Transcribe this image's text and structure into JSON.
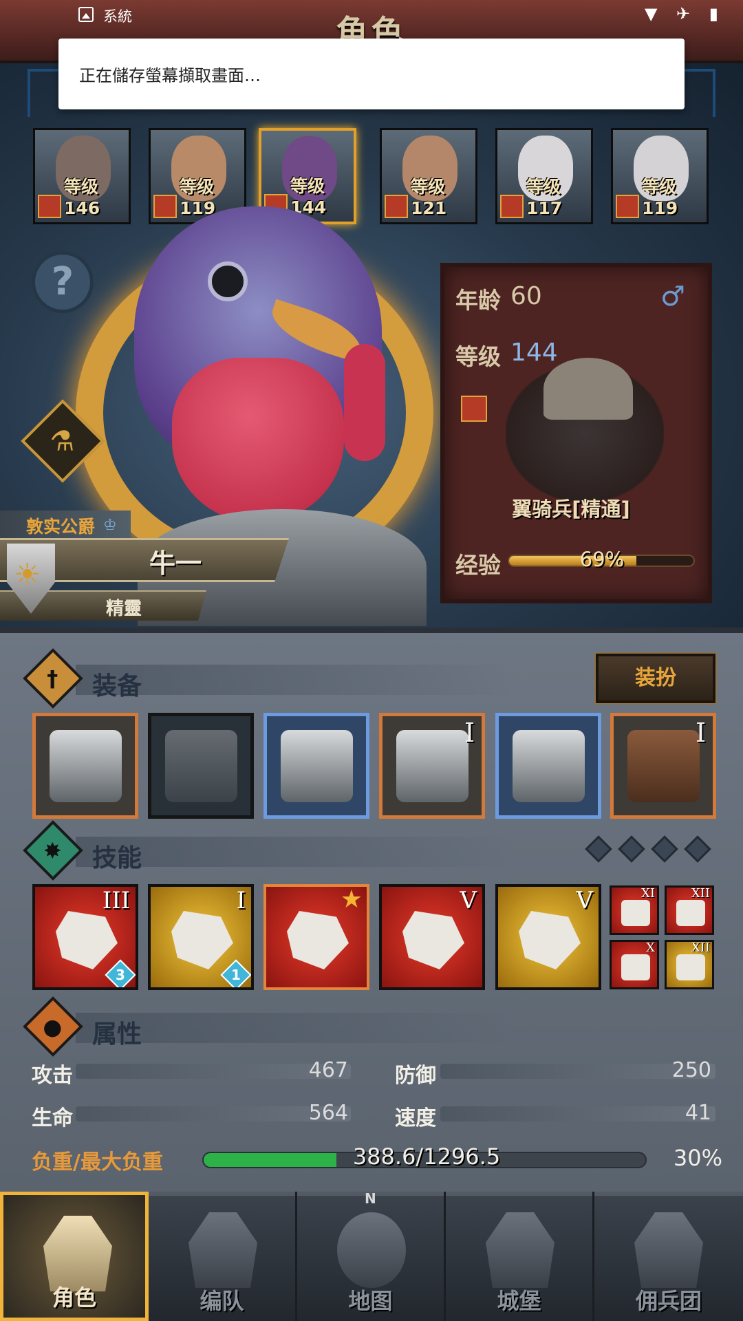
{
  "statusbar": {
    "app": "系統",
    "icons": "▼ ✈ ▮"
  },
  "header": {
    "title": "角色"
  },
  "toast": {
    "text": "正在儲存螢幕擷取畫面…"
  },
  "heroes": [
    {
      "level": "等级146",
      "face": "#7d6a62"
    },
    {
      "level": "等级119",
      "face": "#b88a68"
    },
    {
      "level": "等级144",
      "face": "#6f4a86"
    },
    {
      "level": "等级121",
      "face": "#b4876a"
    },
    {
      "level": "等级117",
      "face": "#d8d6d8"
    },
    {
      "level": "等级119",
      "face": "#d4d2d4"
    }
  ],
  "help": {
    "glyph": "?"
  },
  "potion": {
    "glyph": "⚗"
  },
  "character": {
    "title": "敦实公爵",
    "name": "牛一",
    "race": "精靈"
  },
  "info": {
    "age_label": "年龄",
    "age": "60",
    "gender": "♂",
    "level_label": "等级",
    "level": "144",
    "unit": "翼骑兵[精通]",
    "exp_label": "经验",
    "exp_percent": "69%",
    "exp_fraction": 0.69
  },
  "equipment": {
    "title": "装备",
    "dress_button": "装扮",
    "slots": [
      {
        "style": "",
        "tier": ""
      },
      {
        "style": "dark",
        "tier": ""
      },
      {
        "style": "blue",
        "tier": ""
      },
      {
        "style": "",
        "tier": "I"
      },
      {
        "style": "blue",
        "tier": ""
      },
      {
        "style": "",
        "tier": "I"
      }
    ]
  },
  "skills": {
    "title": "技能",
    "items": [
      {
        "color": "red",
        "tier": "III",
        "gem": "3",
        "star": false
      },
      {
        "color": "gold",
        "tier": "I",
        "gem": "1",
        "star": false
      },
      {
        "color": "red",
        "tier": "",
        "gem": "",
        "star": true
      },
      {
        "color": "red",
        "tier": "V",
        "gem": "",
        "star": false
      },
      {
        "color": "gold",
        "tier": "V",
        "gem": "",
        "star": false
      }
    ],
    "mini": [
      {
        "color": "red",
        "tier": "XI"
      },
      {
        "color": "red",
        "tier": "XII"
      },
      {
        "color": "red",
        "tier": "X"
      },
      {
        "color": "gold",
        "tier": "XII"
      }
    ]
  },
  "attributes": {
    "title": "属性",
    "attack_label": "攻击",
    "attack": "467",
    "defense_label": "防御",
    "defense": "250",
    "hp_label": "生命",
    "hp": "564",
    "speed_label": "速度",
    "speed": "41",
    "load_label": "负重/最大负重",
    "load": "388.6/1296.5",
    "load_pct": "30%",
    "load_fraction": 0.3
  },
  "nav": {
    "items": [
      {
        "label": "角色"
      },
      {
        "label": "编队"
      },
      {
        "label": "地图"
      },
      {
        "label": "城堡"
      },
      {
        "label": "佣兵团"
      }
    ],
    "compass_n": "N"
  },
  "colors": {
    "accent": "#e8a53a",
    "panel": "#4d2422",
    "expbar": "#f3c55d",
    "loadbar": "#2db24a"
  }
}
